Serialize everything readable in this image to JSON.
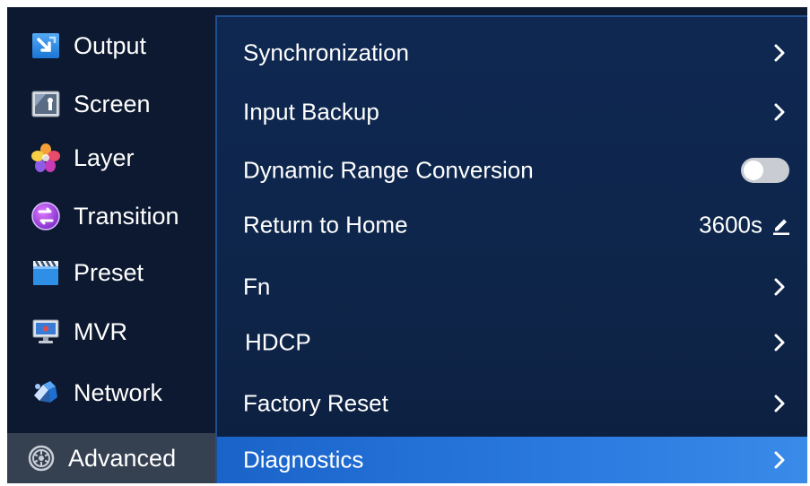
{
  "sidebar": {
    "items": [
      {
        "label": "Output",
        "icon": "output-icon",
        "active": false
      },
      {
        "label": "Screen",
        "icon": "screen-icon",
        "active": false
      },
      {
        "label": "Layer",
        "icon": "layer-icon",
        "active": false
      },
      {
        "label": "Transition",
        "icon": "transition-icon",
        "active": false
      },
      {
        "label": "Preset",
        "icon": "preset-icon",
        "active": false
      },
      {
        "label": "MVR",
        "icon": "mvr-icon",
        "active": false
      },
      {
        "label": "Network",
        "icon": "network-icon",
        "active": false
      },
      {
        "label": "Advanced",
        "icon": "gear-icon",
        "active": true
      }
    ]
  },
  "menu": {
    "items": [
      {
        "label": "Synchronization",
        "control": "chevron"
      },
      {
        "label": "Input Backup",
        "control": "chevron"
      },
      {
        "label": "Dynamic Range Conversion",
        "control": "toggle",
        "toggle_on": false
      },
      {
        "label": "Return to Home",
        "control": "value",
        "value": "3600s"
      },
      {
        "label": "Fn",
        "control": "chevron"
      },
      {
        "label": "HDCP",
        "control": "chevron"
      },
      {
        "label": "Factory Reset",
        "control": "chevron"
      },
      {
        "label": "Diagnostics",
        "control": "chevron",
        "active": true
      }
    ]
  },
  "colors": {
    "background": "#0e1a30",
    "panel": "#0f2852",
    "highlight": "#2a7ae0",
    "sidebar_active": "#354051",
    "toggle_off": "#c9ccd2"
  }
}
